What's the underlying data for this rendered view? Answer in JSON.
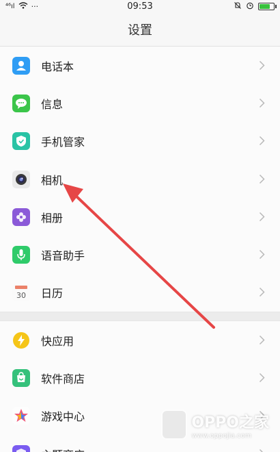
{
  "status_bar": {
    "signal": "⁴⁶ıl",
    "wifi_icon": "wifi-icon",
    "dots": "···",
    "time": "09:53",
    "battery_level": 0.75,
    "battery_color": "#38c23c"
  },
  "header": {
    "title": "设置"
  },
  "group1": [
    {
      "label": "电话本",
      "icon": "contacts-icon",
      "color": "#2f9df4"
    },
    {
      "label": "信息",
      "icon": "messages-icon",
      "color": "#3bc54a"
    },
    {
      "label": "手机管家",
      "icon": "phone-manager-icon",
      "color": "#29c3a5"
    },
    {
      "label": "相机",
      "icon": "camera-icon",
      "color": "#6a6a6a"
    },
    {
      "label": "相册",
      "icon": "gallery-icon",
      "color": "#8b5ad8"
    },
    {
      "label": "语音助手",
      "icon": "voice-assistant-icon",
      "color": "#2fcb6a"
    },
    {
      "label": "日历",
      "icon": "calendar-icon",
      "color": "#e86b4f",
      "day": "30"
    }
  ],
  "group2": [
    {
      "label": "快应用",
      "icon": "quick-app-icon",
      "color": "#f5c518"
    },
    {
      "label": "软件商店",
      "icon": "app-store-icon",
      "color": "#35c17b"
    },
    {
      "label": "游戏中心",
      "icon": "game-center-icon",
      "color": "#f05a7a"
    },
    {
      "label": "主题商店",
      "icon": "theme-store-icon",
      "color": "#7a5cf0"
    }
  ],
  "watermark": {
    "title": "OPPO之家",
    "url": "www.oppojia.com"
  },
  "annotation": {
    "arrow_color": "#e64646"
  }
}
